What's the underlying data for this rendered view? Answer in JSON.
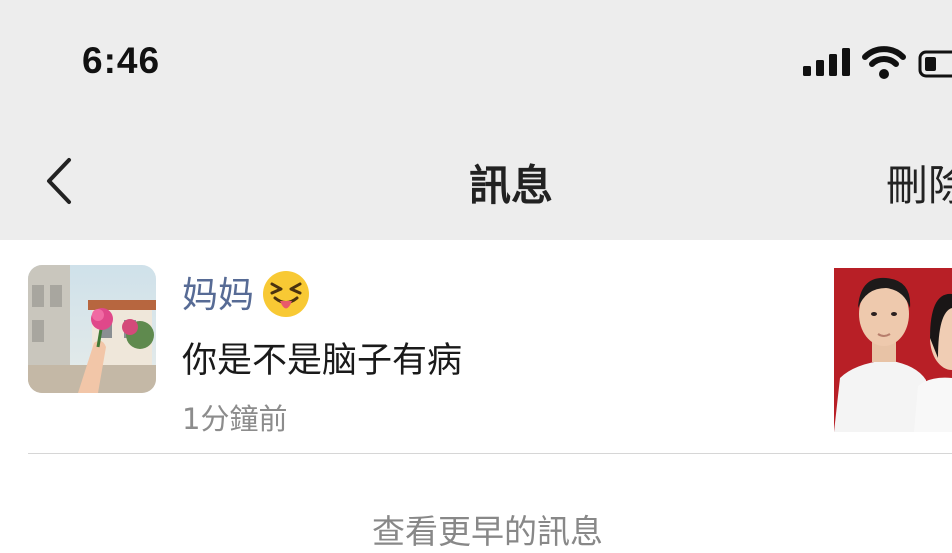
{
  "status_bar": {
    "time": "6:46",
    "icons": [
      "signal-icon",
      "wifi-icon",
      "battery-icon"
    ]
  },
  "nav": {
    "back_icon": "chevron-left-icon",
    "title": "訊息",
    "right_action": "刪除"
  },
  "notification": {
    "sender": "妈妈",
    "emoji": "squinting-face-with-tongue",
    "message": "你是不是脑子有病",
    "time": "1分鐘前"
  },
  "footer": {
    "view_more": "查看更早的訊息"
  },
  "colors": {
    "header_bg": "#ededed",
    "sender_link": "#576b95",
    "thumb_bg": "#b81f26"
  }
}
